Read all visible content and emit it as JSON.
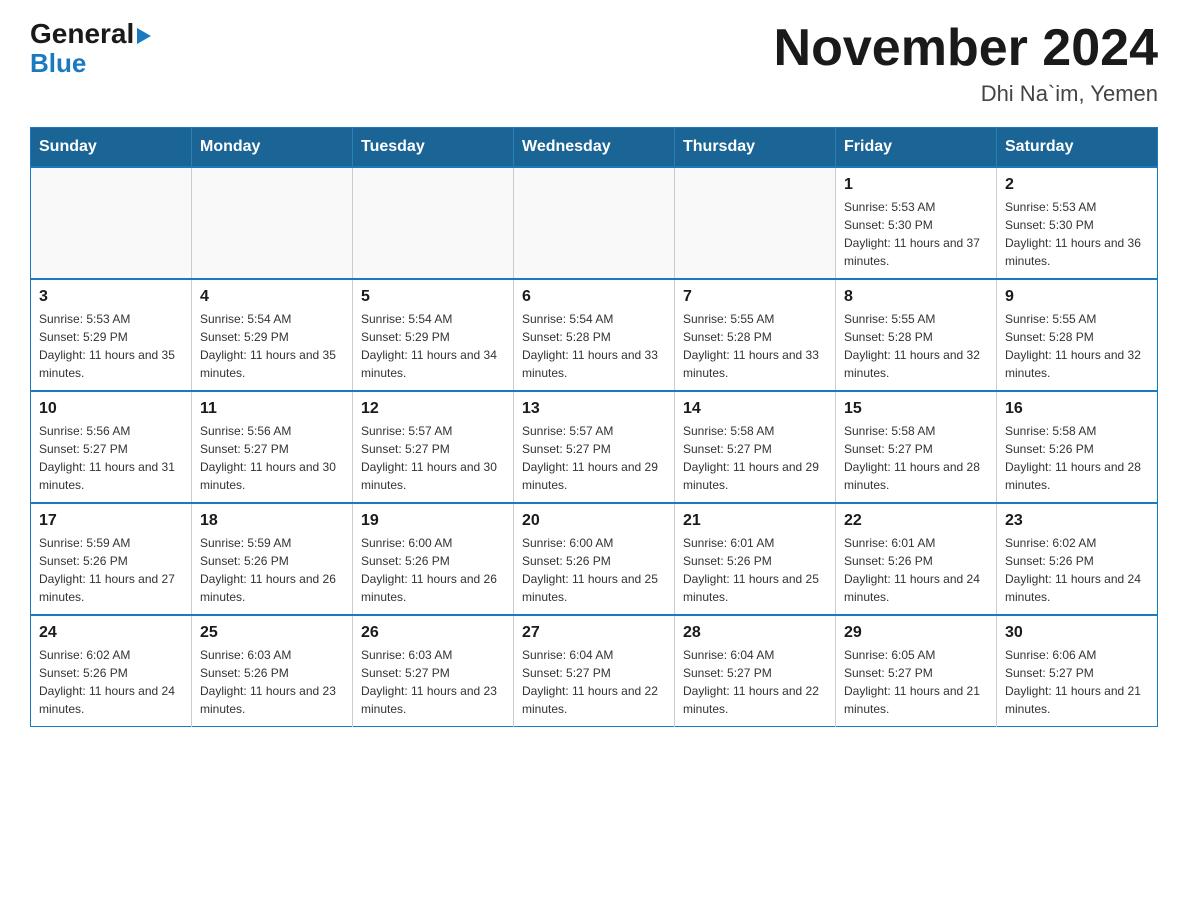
{
  "logo": {
    "general": "General",
    "blue": "Blue"
  },
  "title": "November 2024",
  "location": "Dhi Na`im, Yemen",
  "weekdays": [
    "Sunday",
    "Monday",
    "Tuesday",
    "Wednesday",
    "Thursday",
    "Friday",
    "Saturday"
  ],
  "weeks": [
    [
      {
        "day": "",
        "info": ""
      },
      {
        "day": "",
        "info": ""
      },
      {
        "day": "",
        "info": ""
      },
      {
        "day": "",
        "info": ""
      },
      {
        "day": "",
        "info": ""
      },
      {
        "day": "1",
        "info": "Sunrise: 5:53 AM\nSunset: 5:30 PM\nDaylight: 11 hours and 37 minutes."
      },
      {
        "day": "2",
        "info": "Sunrise: 5:53 AM\nSunset: 5:30 PM\nDaylight: 11 hours and 36 minutes."
      }
    ],
    [
      {
        "day": "3",
        "info": "Sunrise: 5:53 AM\nSunset: 5:29 PM\nDaylight: 11 hours and 35 minutes."
      },
      {
        "day": "4",
        "info": "Sunrise: 5:54 AM\nSunset: 5:29 PM\nDaylight: 11 hours and 35 minutes."
      },
      {
        "day": "5",
        "info": "Sunrise: 5:54 AM\nSunset: 5:29 PM\nDaylight: 11 hours and 34 minutes."
      },
      {
        "day": "6",
        "info": "Sunrise: 5:54 AM\nSunset: 5:28 PM\nDaylight: 11 hours and 33 minutes."
      },
      {
        "day": "7",
        "info": "Sunrise: 5:55 AM\nSunset: 5:28 PM\nDaylight: 11 hours and 33 minutes."
      },
      {
        "day": "8",
        "info": "Sunrise: 5:55 AM\nSunset: 5:28 PM\nDaylight: 11 hours and 32 minutes."
      },
      {
        "day": "9",
        "info": "Sunrise: 5:55 AM\nSunset: 5:28 PM\nDaylight: 11 hours and 32 minutes."
      }
    ],
    [
      {
        "day": "10",
        "info": "Sunrise: 5:56 AM\nSunset: 5:27 PM\nDaylight: 11 hours and 31 minutes."
      },
      {
        "day": "11",
        "info": "Sunrise: 5:56 AM\nSunset: 5:27 PM\nDaylight: 11 hours and 30 minutes."
      },
      {
        "day": "12",
        "info": "Sunrise: 5:57 AM\nSunset: 5:27 PM\nDaylight: 11 hours and 30 minutes."
      },
      {
        "day": "13",
        "info": "Sunrise: 5:57 AM\nSunset: 5:27 PM\nDaylight: 11 hours and 29 minutes."
      },
      {
        "day": "14",
        "info": "Sunrise: 5:58 AM\nSunset: 5:27 PM\nDaylight: 11 hours and 29 minutes."
      },
      {
        "day": "15",
        "info": "Sunrise: 5:58 AM\nSunset: 5:27 PM\nDaylight: 11 hours and 28 minutes."
      },
      {
        "day": "16",
        "info": "Sunrise: 5:58 AM\nSunset: 5:26 PM\nDaylight: 11 hours and 28 minutes."
      }
    ],
    [
      {
        "day": "17",
        "info": "Sunrise: 5:59 AM\nSunset: 5:26 PM\nDaylight: 11 hours and 27 minutes."
      },
      {
        "day": "18",
        "info": "Sunrise: 5:59 AM\nSunset: 5:26 PM\nDaylight: 11 hours and 26 minutes."
      },
      {
        "day": "19",
        "info": "Sunrise: 6:00 AM\nSunset: 5:26 PM\nDaylight: 11 hours and 26 minutes."
      },
      {
        "day": "20",
        "info": "Sunrise: 6:00 AM\nSunset: 5:26 PM\nDaylight: 11 hours and 25 minutes."
      },
      {
        "day": "21",
        "info": "Sunrise: 6:01 AM\nSunset: 5:26 PM\nDaylight: 11 hours and 25 minutes."
      },
      {
        "day": "22",
        "info": "Sunrise: 6:01 AM\nSunset: 5:26 PM\nDaylight: 11 hours and 24 minutes."
      },
      {
        "day": "23",
        "info": "Sunrise: 6:02 AM\nSunset: 5:26 PM\nDaylight: 11 hours and 24 minutes."
      }
    ],
    [
      {
        "day": "24",
        "info": "Sunrise: 6:02 AM\nSunset: 5:26 PM\nDaylight: 11 hours and 24 minutes."
      },
      {
        "day": "25",
        "info": "Sunrise: 6:03 AM\nSunset: 5:26 PM\nDaylight: 11 hours and 23 minutes."
      },
      {
        "day": "26",
        "info": "Sunrise: 6:03 AM\nSunset: 5:27 PM\nDaylight: 11 hours and 23 minutes."
      },
      {
        "day": "27",
        "info": "Sunrise: 6:04 AM\nSunset: 5:27 PM\nDaylight: 11 hours and 22 minutes."
      },
      {
        "day": "28",
        "info": "Sunrise: 6:04 AM\nSunset: 5:27 PM\nDaylight: 11 hours and 22 minutes."
      },
      {
        "day": "29",
        "info": "Sunrise: 6:05 AM\nSunset: 5:27 PM\nDaylight: 11 hours and 21 minutes."
      },
      {
        "day": "30",
        "info": "Sunrise: 6:06 AM\nSunset: 5:27 PM\nDaylight: 11 hours and 21 minutes."
      }
    ]
  ]
}
